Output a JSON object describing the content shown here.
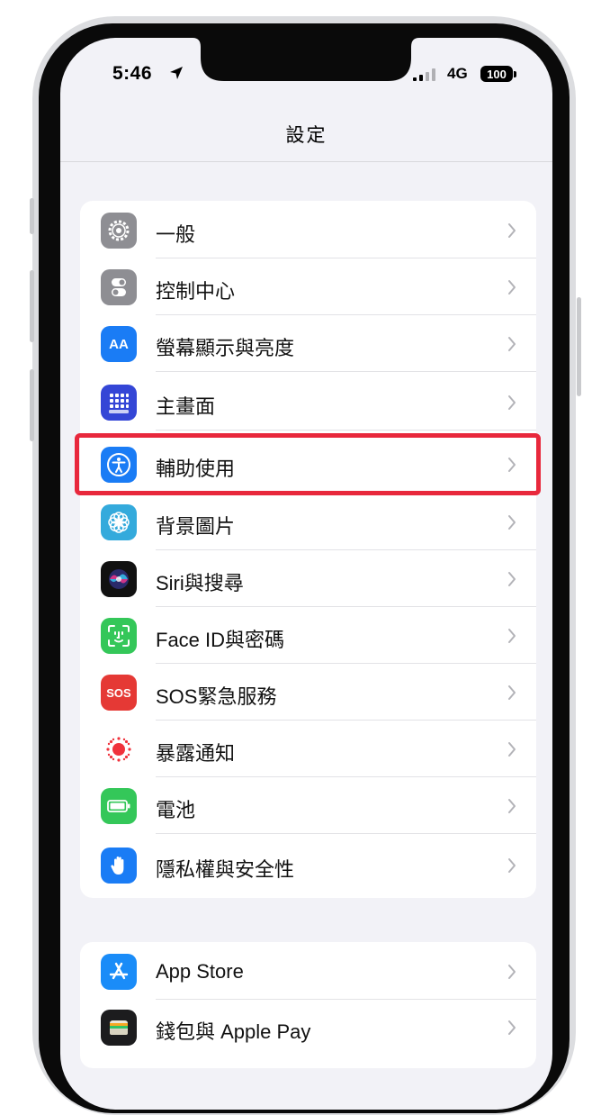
{
  "status_bar": {
    "time": "5:46",
    "network": "4G",
    "battery": "100"
  },
  "nav": {
    "title": "設定"
  },
  "groups": [
    {
      "items": [
        {
          "label": "一般",
          "icon": "gear-icon",
          "color": "#8e8e93"
        },
        {
          "label": "控制中心",
          "icon": "toggles-icon",
          "color": "#8e8e93"
        },
        {
          "label": "螢幕顯示與亮度",
          "icon": "text-size-icon",
          "icon_text": "AA",
          "color": "#1a7cf5"
        },
        {
          "label": "主畫面",
          "icon": "home-grid-icon",
          "color": "#3446d6"
        },
        {
          "label": "輔助使用",
          "icon": "accessibility-icon",
          "color": "#1a7cf5"
        },
        {
          "label": "背景圖片",
          "icon": "wallpaper-flower-icon",
          "color": "#34aadc"
        },
        {
          "label": "Siri與搜尋",
          "icon": "siri-icon",
          "color": "#111111"
        },
        {
          "label": "Face ID與密碼",
          "icon": "face-id-icon",
          "color": "#34c759"
        },
        {
          "label": "SOS緊急服務",
          "icon": "sos-icon",
          "icon_text": "SOS",
          "color": "#e53935"
        },
        {
          "label": "暴露通知",
          "icon": "exposure-icon",
          "color": "#ffffff"
        },
        {
          "label": "電池",
          "icon": "battery-icon",
          "color": "#34c759"
        },
        {
          "label": "隱私權與安全性",
          "icon": "hand-icon",
          "color": "#1a7cf5"
        }
      ]
    },
    {
      "items": [
        {
          "label": "App Store",
          "icon": "app-store-icon",
          "color": "#1a8cf8"
        },
        {
          "label": "錢包與 Apple Pay",
          "icon": "wallet-icon",
          "color": "#1c1c1e"
        }
      ]
    }
  ],
  "highlighted_item": "輔助使用"
}
